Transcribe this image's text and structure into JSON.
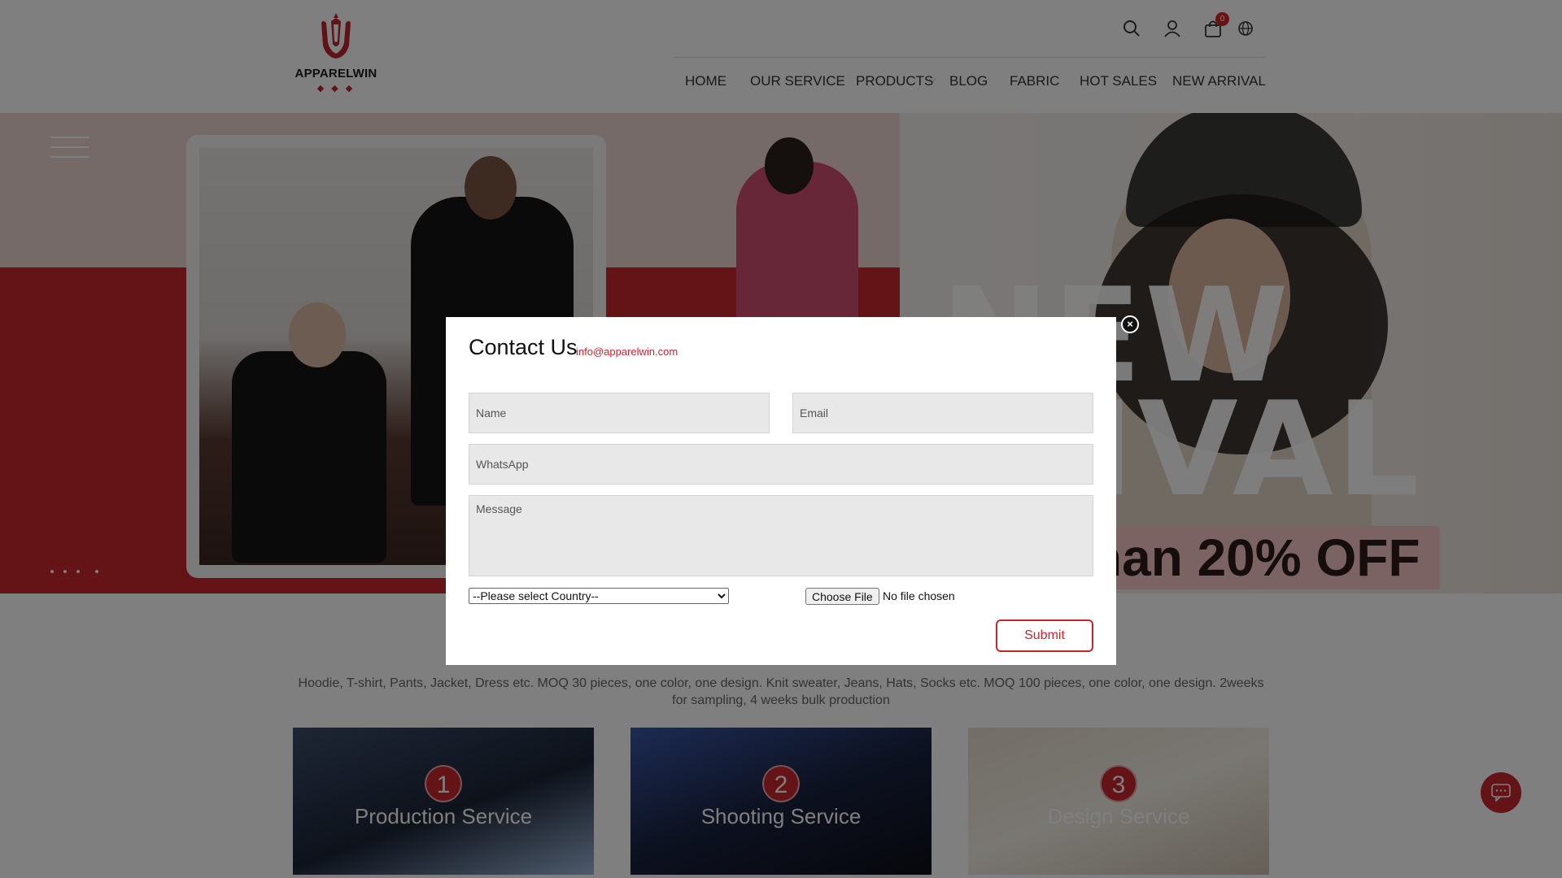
{
  "brand": {
    "name": "APPARELWIN",
    "logo_dots": "◆ ◆ ◆"
  },
  "header": {
    "cart_count": "0",
    "nav": [
      {
        "label": "HOME"
      },
      {
        "label": "OUR SERVICE"
      },
      {
        "label": "PRODUCTS"
      },
      {
        "label": "BLOG"
      },
      {
        "label": "FABRIC"
      },
      {
        "label": "HOT SALES"
      },
      {
        "label": "NEW ARRIVAL"
      }
    ],
    "icons": [
      "search-icon",
      "user-icon",
      "cart-icon",
      "globe-icon"
    ]
  },
  "hero": {
    "headline_line1": "NEW",
    "headline_line2": "RRIVAL",
    "promo_prefix": "han ",
    "promo_value": "20% OFF",
    "colors": {
      "red": "#c8262d",
      "pink": "#ecd4d2"
    }
  },
  "services": {
    "description": "Hoodie, T-shirt, Pants, Jacket, Dress etc. MOQ 30 pieces, one color, one design. Knit sweater, Jeans, Hats, Socks etc. MOQ 100 pieces, one color, one design. 2weeks for sampling, 4 weeks bulk production",
    "cards": [
      {
        "number": "1",
        "title": "Production Service"
      },
      {
        "number": "2",
        "title": "Shooting Service"
      },
      {
        "number": "3",
        "title": "Design Service"
      }
    ]
  },
  "modal": {
    "title": "Contact Us",
    "email": "info@apparelwin.com",
    "name_placeholder": "Name",
    "email_placeholder": "Email",
    "whatsapp_placeholder": "WhatsApp",
    "message_placeholder": "Message",
    "country_selected": "--Please select Country--",
    "file_button": "Choose File",
    "file_status": "No file chosen",
    "submit_label": "Submit",
    "close_glyph": "×"
  }
}
